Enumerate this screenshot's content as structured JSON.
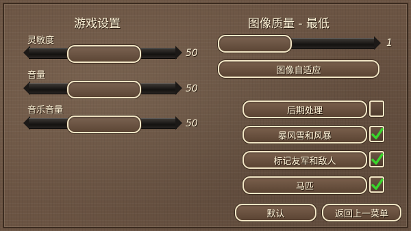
{
  "game_settings": {
    "title": "游戏设置",
    "sliders": [
      {
        "label": "灵敏度",
        "value": "50",
        "level": 0.5
      },
      {
        "label": "音量",
        "value": "50",
        "level": 0.5
      },
      {
        "label": "音乐音量",
        "value": "50",
        "level": 0.5
      }
    ]
  },
  "graphics": {
    "title": "图像质量 - 最低",
    "quality_value": "1",
    "quality_level": 0,
    "auto_adapt_label": "图像自适应",
    "options": [
      {
        "label": "后期处理",
        "checked": false
      },
      {
        "label": "暴风雪和风暴",
        "checked": true
      },
      {
        "label": "标记友军和敌人",
        "checked": true
      },
      {
        "label": "马匹",
        "checked": true
      }
    ]
  },
  "footer": {
    "default_label": "默认",
    "back_label": "返回上一菜单"
  },
  "colors": {
    "check": "#39d52c",
    "panel": "#6b5443",
    "border": "#f3e7c6"
  }
}
